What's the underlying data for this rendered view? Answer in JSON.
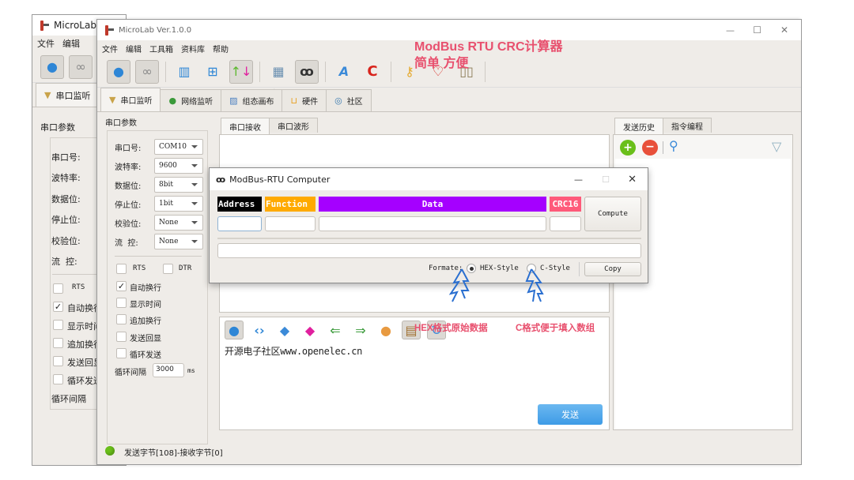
{
  "annotation": {
    "title": "ModBus RTU CRC计算器",
    "subtitle": "简单 方便",
    "hex_note": "HEX格式原始数据",
    "c_note": "C格式便于填入数组",
    "color": "#e8506e"
  },
  "back_window": {
    "title": "MicroLab",
    "menu": [
      "文件",
      "编辑"
    ],
    "tab": "串口监听",
    "group_title": "串口参数",
    "fields": [
      "串口号:",
      "波特率:",
      "数据位:",
      "停止位:",
      "校验位:",
      "流  控:"
    ],
    "checkboxes": [
      {
        "label": "RTS",
        "checked": false
      },
      {
        "label": "自动换行",
        "checked": true
      },
      {
        "label": "显示时间",
        "checked": false
      },
      {
        "label": "追加换行",
        "checked": false
      },
      {
        "label": "发送回显",
        "checked": false
      },
      {
        "label": "循环发送",
        "checked": false
      }
    ],
    "interval_label": "循环间隔"
  },
  "main_window": {
    "title": "MicroLab Ver.1.0.0",
    "menu": [
      "文件",
      "编辑",
      "工具箱",
      "资料库",
      "帮助"
    ],
    "toolbar": [
      {
        "icon": "connect-icon",
        "glyph": "🔌",
        "pressed": true
      },
      {
        "icon": "link-icon",
        "glyph": "🔗",
        "pressed": true
      },
      {
        "icon": "columns-icon",
        "glyph": "▥",
        "pressed": false
      },
      {
        "icon": "window-layout-icon",
        "glyph": "🗔",
        "pressed": false
      },
      {
        "icon": "up-down-arrows-icon",
        "glyph": "⇅",
        "pressed": true
      },
      {
        "icon": "calculator-icon",
        "glyph": "🖩",
        "pressed": false
      },
      {
        "icon": "modbus-crc-icon",
        "glyph": "⚲",
        "pressed": true
      },
      {
        "icon": "font-icon",
        "glyph": "A",
        "pressed": false
      },
      {
        "icon": "flame-c-icon",
        "glyph": "C",
        "pressed": false
      },
      {
        "icon": "key-icon",
        "glyph": "🔑",
        "pressed": false
      },
      {
        "icon": "heart-icon",
        "glyph": "♡",
        "pressed": false
      },
      {
        "icon": "book-icon",
        "glyph": "📖",
        "pressed": false
      }
    ],
    "tabs": [
      {
        "label": "串口监听",
        "icon": "funnel-icon",
        "glyph": "▼",
        "active": true
      },
      {
        "label": "网络监听",
        "icon": "globe-icon",
        "glyph": "🌐",
        "active": false
      },
      {
        "label": "组态画布",
        "icon": "canvas-icon",
        "glyph": "🖼",
        "active": false
      },
      {
        "label": "硬件",
        "icon": "cart-icon",
        "glyph": "🛒",
        "active": false
      },
      {
        "label": "社区",
        "icon": "chat-icon",
        "glyph": "💬",
        "active": false
      }
    ],
    "serial": {
      "group_title": "串口参数",
      "fields": [
        {
          "label": "串口号:",
          "value": "COM10"
        },
        {
          "label": "波特率:",
          "value": "9600"
        },
        {
          "label": "数据位:",
          "value": "8bit"
        },
        {
          "label": "停止位:",
          "value": "1bit"
        },
        {
          "label": "校验位:",
          "value": "None"
        },
        {
          "label": "流  控:",
          "value": "None"
        }
      ],
      "rts": {
        "label": "RTS",
        "checked": false
      },
      "dtr": {
        "label": "DTR",
        "checked": false
      },
      "checkboxes": [
        {
          "label": "自动换行",
          "checked": true
        },
        {
          "label": "显示时间",
          "checked": false
        },
        {
          "label": "追加换行",
          "checked": false
        },
        {
          "label": "发送回显",
          "checked": false
        },
        {
          "label": "循环发送",
          "checked": false
        }
      ],
      "interval_label": "循环间隔",
      "interval_value": "3000",
      "interval_unit": "ms"
    },
    "receive_tabs": [
      {
        "label": "串口接收",
        "active": true
      },
      {
        "label": "串口波形",
        "active": false
      }
    ],
    "send_toolbar": [
      {
        "icon": "connect-icon",
        "glyph": "🔌"
      },
      {
        "icon": "code-brackets-icon",
        "glyph": "‹›"
      },
      {
        "icon": "eraser-blue-icon",
        "glyph": "◆"
      },
      {
        "icon": "eraser-pink-icon",
        "glyph": "◆"
      },
      {
        "icon": "import-icon",
        "glyph": "⇐"
      },
      {
        "icon": "export-icon",
        "glyph": "⇒"
      },
      {
        "icon": "palette-icon",
        "glyph": "🎨"
      },
      {
        "icon": "format-icon",
        "glyph": "▤"
      },
      {
        "icon": "refresh-icon",
        "glyph": "↻"
      }
    ],
    "send_text": "开源电子社区www.openelec.cn",
    "send_button": "发送",
    "history_tabs": [
      {
        "label": "发送历史",
        "active": true
      },
      {
        "label": "指令编程",
        "active": false
      }
    ],
    "status": "发送字节[108]-接收字节[0]",
    "status_color": "#6abf1a"
  },
  "dialog": {
    "title": "ModBus-RTU Computer",
    "headers": [
      {
        "label": "Address",
        "bg": "#000000",
        "fg": "#ffffff"
      },
      {
        "label": "Function",
        "bg": "#ffaa00",
        "fg": "#ffffff"
      },
      {
        "label": "Data",
        "bg": "#a500ff",
        "fg": "#ffffff"
      },
      {
        "label": "CRC16",
        "bg": "#ff5a7a",
        "fg": "#ffffff"
      }
    ],
    "inputs": {
      "address": "",
      "function": "",
      "data": "",
      "crc16": ""
    },
    "result": "",
    "compute_button": "Compute",
    "format_label": "Formate:",
    "format_options": [
      {
        "label": "HEX-Style",
        "selected": true
      },
      {
        "label": "C-Style",
        "selected": false
      }
    ],
    "copy_button": "Copy"
  },
  "window_controls": {
    "minimize": "—",
    "maximize": "☐",
    "close": "✕"
  }
}
